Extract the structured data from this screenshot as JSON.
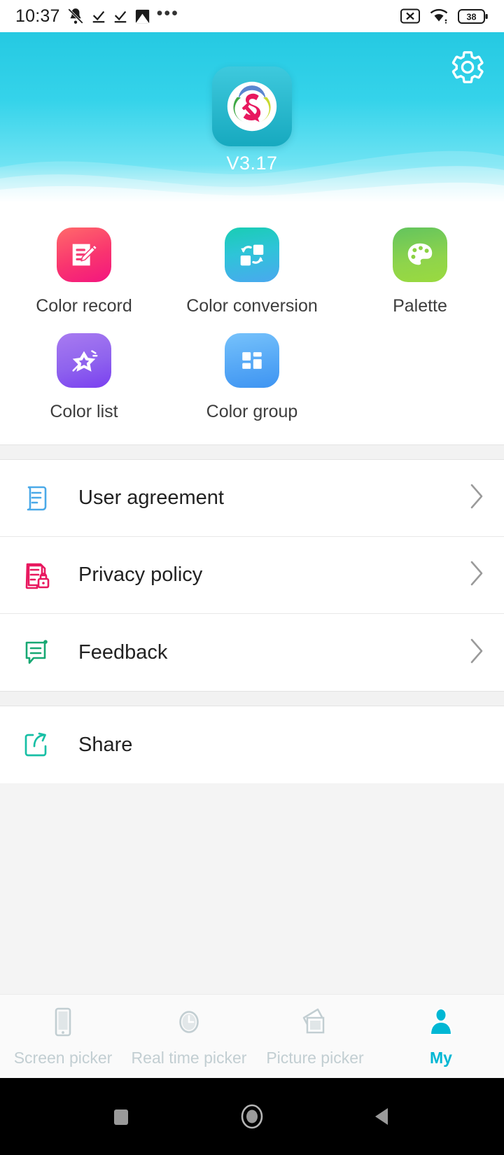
{
  "status_bar": {
    "time": "10:37",
    "left_icons": [
      "bell-muted-icon",
      "check-download-icon",
      "check-download-icon",
      "image-broken-icon",
      "more-dots-icon"
    ],
    "more_dots": "•••",
    "right_icons": [
      "sim-card-x-icon",
      "wifi-icon",
      "battery-icon"
    ],
    "battery_level": "38"
  },
  "header": {
    "settings_icon": "gear-icon",
    "app_logo": "app-logo-s-palette",
    "version": "V3.17",
    "background_color": "#35d3ea"
  },
  "features": [
    {
      "label": "Color record",
      "icon": "note-pencil-icon",
      "color": "#f9356f"
    },
    {
      "label": "Color conversion",
      "icon": "swap-squares-icon",
      "color": "#2ec4d8"
    },
    {
      "label": "Palette",
      "icon": "paint-palette-icon",
      "color": "#8fd44b"
    },
    {
      "label": "Color list",
      "icon": "magic-star-icon",
      "color": "#8f63ee"
    },
    {
      "label": "Color group",
      "icon": "grid-blocks-icon",
      "color": "#56a8f6"
    }
  ],
  "menu_group_1": [
    {
      "label": "User agreement",
      "icon": "document-scroll-icon",
      "color": "#4aa9e8",
      "chevron": true
    },
    {
      "label": "Privacy policy",
      "icon": "document-lock-icon",
      "color": "#e8185f",
      "chevron": true
    },
    {
      "label": "Feedback",
      "icon": "speech-bubble-icon",
      "color": "#17a873",
      "chevron": true
    }
  ],
  "menu_group_2": [
    {
      "label": "Share",
      "icon": "share-arrow-icon",
      "color": "#17bfa5",
      "chevron": false
    }
  ],
  "bottom_nav": {
    "active_color": "#00b7d4",
    "inactive_color": "#c2ced2",
    "tabs": [
      {
        "label": "Screen picker",
        "icon": "phone-screen-icon",
        "active": false
      },
      {
        "label": "Real time picker",
        "icon": "clock-icon",
        "active": false
      },
      {
        "label": "Picture picker",
        "icon": "photos-icon",
        "active": false
      },
      {
        "label": "My",
        "icon": "person-icon",
        "active": true
      }
    ]
  },
  "android_nav": {
    "buttons": [
      {
        "icon": "recents-square-icon"
      },
      {
        "icon": "home-circle-icon"
      },
      {
        "icon": "back-triangle-icon"
      }
    ]
  }
}
